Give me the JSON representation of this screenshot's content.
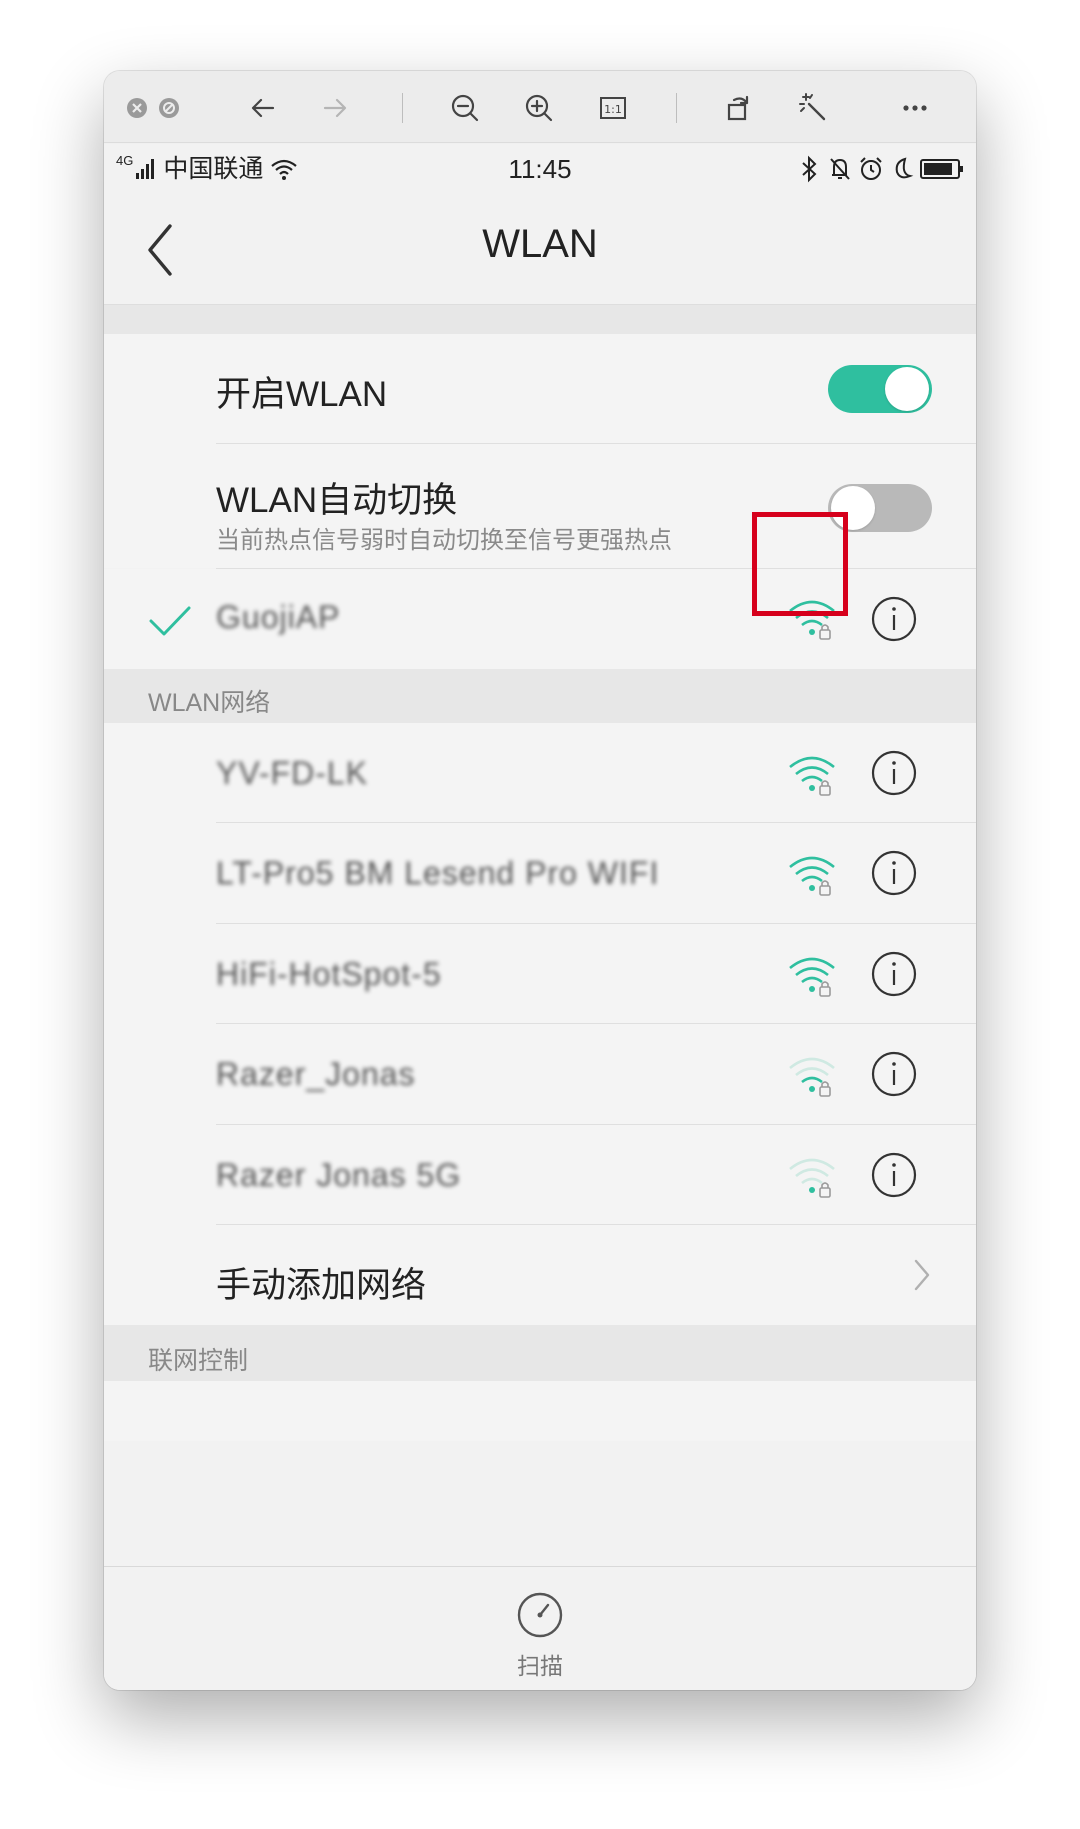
{
  "toolbar": {
    "icons": [
      "close-icon",
      "minimize-icon",
      "back-arrow-icon",
      "forward-arrow-icon",
      "zoom-out-icon",
      "zoom-in-icon",
      "actual-size-icon",
      "rotate-icon",
      "magic-wand-icon",
      "more-icon"
    ],
    "actual_size_label": "1:1"
  },
  "status_bar": {
    "signal": "4G",
    "carrier": "中国联通",
    "time": "11:45"
  },
  "nav": {
    "title": "WLAN"
  },
  "settings": {
    "wlan_toggle": {
      "label": "开启WLAN",
      "on": true
    },
    "auto_switch": {
      "label": "WLAN自动切换",
      "sublabel": "当前热点信号弱时自动切换至信号更强热点",
      "on": false
    }
  },
  "connected_network": {
    "ssid": "GuojiAP",
    "signal_level": 4,
    "secured": true
  },
  "wlan_networks": {
    "section_title": "WLAN网络",
    "items": [
      {
        "ssid": "YV-FD-LK",
        "signal_level": 4,
        "secured": true
      },
      {
        "ssid": "LT-Pro5 BM Lesend Pro WIFI",
        "signal_level": 4,
        "secured": true
      },
      {
        "ssid": "HiFi-HotSpot-5",
        "signal_level": 4,
        "secured": true
      },
      {
        "ssid": "Razer_Jonas",
        "signal_level": 2,
        "secured": true
      },
      {
        "ssid": "Razer Jonas 5G",
        "signal_level": 1,
        "secured": true
      }
    ],
    "add_network_label": "手动添加网络"
  },
  "network_control": {
    "section_title": "联网控制"
  },
  "bottom": {
    "scan_label": "扫描"
  },
  "colors": {
    "accent": "#2fbf9f",
    "highlight": "#d6001c",
    "toggle_off": "#b9b9b9"
  }
}
